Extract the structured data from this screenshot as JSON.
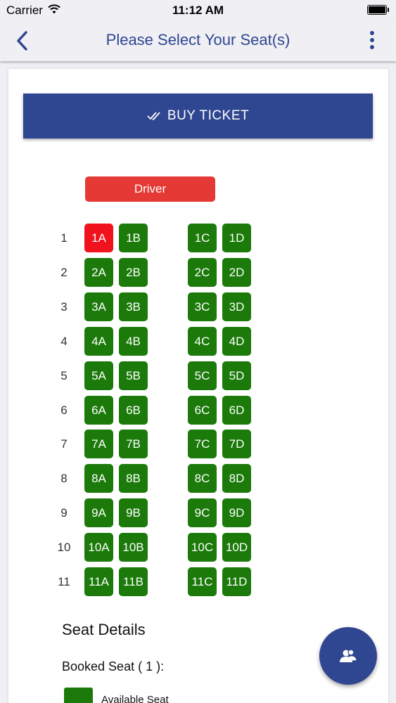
{
  "status_bar": {
    "carrier": "Carrier",
    "time": "11:12 AM"
  },
  "nav": {
    "title": "Please Select Your Seat(s)",
    "back_icon": "chevron-left-icon",
    "menu_icon": "vertical-dots-icon"
  },
  "buy_button": {
    "label": "BUY TICKET",
    "icon": "double-check-icon"
  },
  "driver_label": "Driver",
  "seat_map": {
    "rows": [
      {
        "number": "1",
        "seats": [
          {
            "label": "1A",
            "status": "selected"
          },
          {
            "label": "1B",
            "status": "available"
          },
          {
            "label": "1C",
            "status": "available"
          },
          {
            "label": "1D",
            "status": "available"
          }
        ]
      },
      {
        "number": "2",
        "seats": [
          {
            "label": "2A",
            "status": "available"
          },
          {
            "label": "2B",
            "status": "available"
          },
          {
            "label": "2C",
            "status": "available"
          },
          {
            "label": "2D",
            "status": "available"
          }
        ]
      },
      {
        "number": "3",
        "seats": [
          {
            "label": "3A",
            "status": "available"
          },
          {
            "label": "3B",
            "status": "available"
          },
          {
            "label": "3C",
            "status": "available"
          },
          {
            "label": "3D",
            "status": "available"
          }
        ]
      },
      {
        "number": "4",
        "seats": [
          {
            "label": "4A",
            "status": "available"
          },
          {
            "label": "4B",
            "status": "available"
          },
          {
            "label": "4C",
            "status": "available"
          },
          {
            "label": "4D",
            "status": "available"
          }
        ]
      },
      {
        "number": "5",
        "seats": [
          {
            "label": "5A",
            "status": "available"
          },
          {
            "label": "5B",
            "status": "available"
          },
          {
            "label": "5C",
            "status": "available"
          },
          {
            "label": "5D",
            "status": "available"
          }
        ]
      },
      {
        "number": "6",
        "seats": [
          {
            "label": "6A",
            "status": "available"
          },
          {
            "label": "6B",
            "status": "available"
          },
          {
            "label": "6C",
            "status": "available"
          },
          {
            "label": "6D",
            "status": "available"
          }
        ]
      },
      {
        "number": "7",
        "seats": [
          {
            "label": "7A",
            "status": "available"
          },
          {
            "label": "7B",
            "status": "available"
          },
          {
            "label": "7C",
            "status": "available"
          },
          {
            "label": "7D",
            "status": "available"
          }
        ]
      },
      {
        "number": "8",
        "seats": [
          {
            "label": "8A",
            "status": "available"
          },
          {
            "label": "8B",
            "status": "available"
          },
          {
            "label": "8C",
            "status": "available"
          },
          {
            "label": "8D",
            "status": "available"
          }
        ]
      },
      {
        "number": "9",
        "seats": [
          {
            "label": "9A",
            "status": "available"
          },
          {
            "label": "9B",
            "status": "available"
          },
          {
            "label": "9C",
            "status": "available"
          },
          {
            "label": "9D",
            "status": "available"
          }
        ]
      },
      {
        "number": "10",
        "seats": [
          {
            "label": "10A",
            "status": "available"
          },
          {
            "label": "10B",
            "status": "available"
          },
          {
            "label": "10C",
            "status": "available"
          },
          {
            "label": "10D",
            "status": "available"
          }
        ]
      },
      {
        "number": "11",
        "seats": [
          {
            "label": "11A",
            "status": "available"
          },
          {
            "label": "11B",
            "status": "available"
          },
          {
            "label": "11C",
            "status": "available"
          },
          {
            "label": "11D",
            "status": "available"
          }
        ]
      }
    ]
  },
  "seat_details": {
    "title": "Seat Details",
    "booked_label": "Booked Seat ( 1 ):",
    "legend_available": "Available Seat"
  },
  "fab_icon": "group-users-icon",
  "colors": {
    "primary": "#2f4690",
    "available": "#1b7a0a",
    "selected": "#f0121d",
    "driver": "#e53935"
  }
}
